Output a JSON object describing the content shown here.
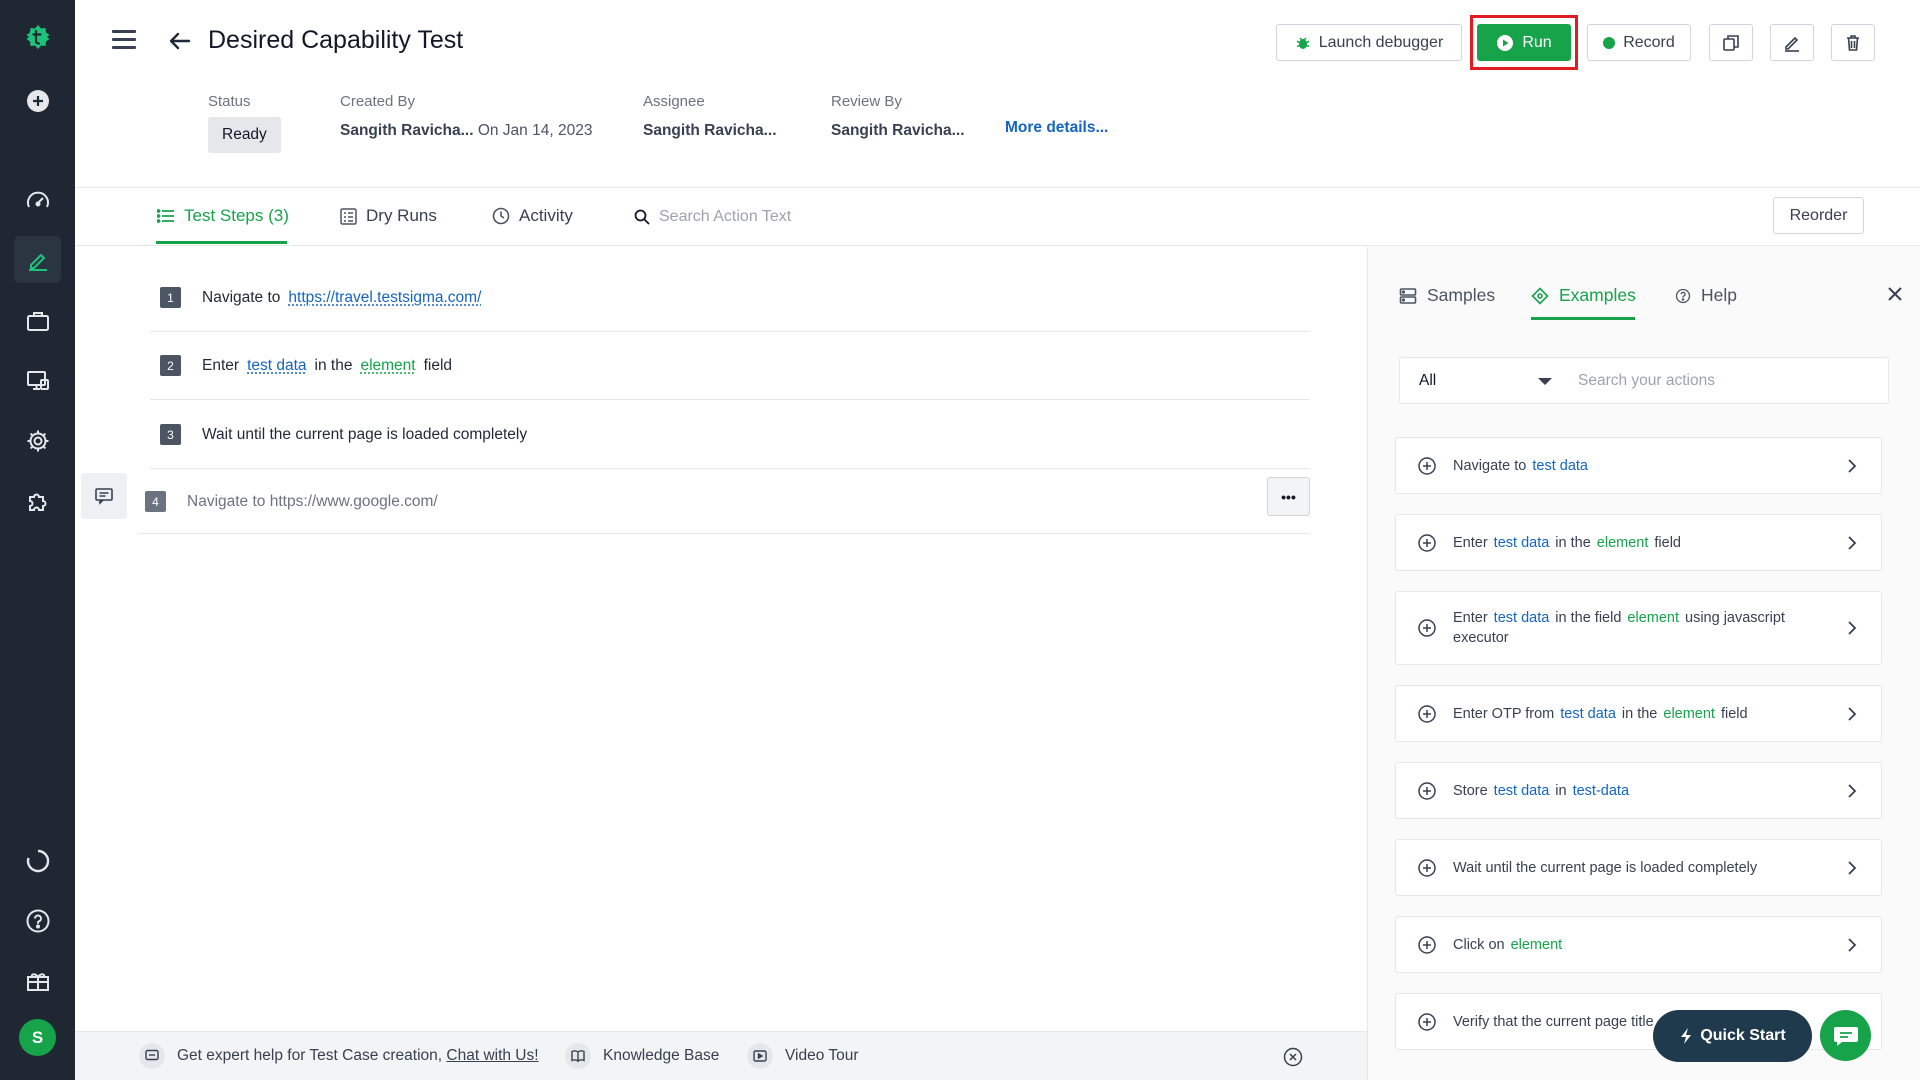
{
  "header": {
    "title": "Desired Capability Test",
    "status_label": "Status",
    "status_value": "Ready",
    "created_by_label": "Created By",
    "created_by_value": "Sangith Ravicha...",
    "created_on": "On Jan 14, 2023",
    "assignee_label": "Assignee",
    "assignee_value": "Sangith Ravicha...",
    "review_by_label": "Review By",
    "review_by_value": "Sangith Ravicha...",
    "more_details": "More details..."
  },
  "toolbar": {
    "launch_debugger": "Launch debugger",
    "run": "Run",
    "record": "Record"
  },
  "tabs": {
    "test_steps": "Test Steps (3)",
    "dry_runs": "Dry Runs",
    "activity": "Activity",
    "search_placeholder": "Search Action Text",
    "reorder": "Reorder"
  },
  "steps": [
    {
      "num": "1",
      "parts": [
        "Navigate to",
        "https://travel.testsigma.com/"
      ]
    },
    {
      "num": "2",
      "parts": [
        "Enter",
        "test data",
        "in the",
        "element",
        "field"
      ]
    },
    {
      "num": "3",
      "parts": [
        "Wait until the current page is loaded completely"
      ]
    },
    {
      "num": "4",
      "parts": [
        "Navigate to https://www.google.com/"
      ]
    }
  ],
  "panel": {
    "tab_samples": "Samples",
    "tab_examples": "Examples",
    "tab_help": "Help",
    "filter_value": "All",
    "search_placeholder": "Search your actions",
    "cards": [
      {
        "t1": "Navigate to",
        "t2": "test data"
      },
      {
        "t1": "Enter",
        "t2": "test data",
        "t3": "in the",
        "t4": "element",
        "t5": "field"
      },
      {
        "t1": "Enter",
        "t2": "test data",
        "t3": "in the field",
        "t4": "element",
        "t5": "using javascript executor"
      },
      {
        "t1": "Enter OTP from",
        "t2": "test data",
        "t3": "in the",
        "t4": "element",
        "t5": "field"
      },
      {
        "t1": "Store",
        "t2": "test data",
        "t3": "in",
        "t4": "test-data"
      },
      {
        "t1": "Wait until the current page is loaded completely"
      },
      {
        "t1": "Click on",
        "t2": "element"
      },
      {
        "t1": "Verify that the current page title"
      }
    ]
  },
  "floating": {
    "quick_start": "Quick Start"
  },
  "bottom": {
    "help_text": "Get expert help for Test Case creation,",
    "chat_link": "Chat with Us!",
    "knowledge_base": "Knowledge Base",
    "video_tour": "Video Tour"
  },
  "user": {
    "avatar_initial": "S"
  },
  "colors": {
    "brand_green": "#16a34a",
    "rail_bg": "#1f2733",
    "link_blue": "#1565c0",
    "highlight_red": "#e31b23"
  }
}
